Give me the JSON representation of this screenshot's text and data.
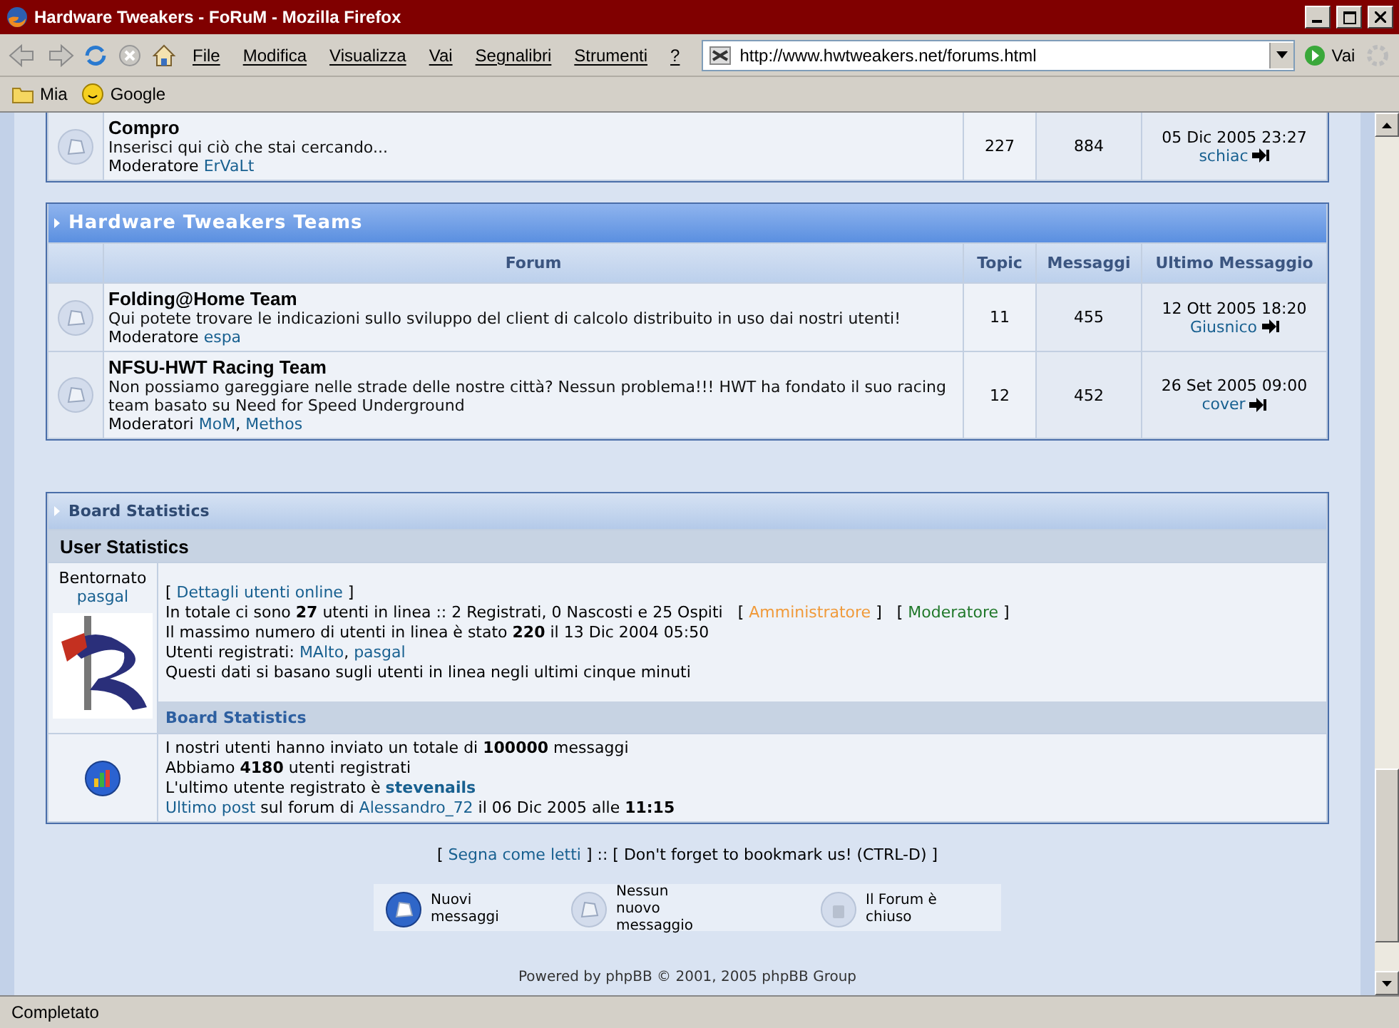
{
  "window": {
    "title": "Hardware Tweakers - FoRuM - Mozilla Firefox"
  },
  "menu": [
    "File",
    "Modifica",
    "Visualizza",
    "Vai",
    "Segnalibri",
    "Strumenti",
    "?"
  ],
  "address": {
    "value": "http://www.hwtweakers.net/forums.html",
    "go": "Vai"
  },
  "bookmarks": [
    {
      "label": "Mia",
      "kind": "folder"
    },
    {
      "label": "Google",
      "kind": "smiley"
    }
  ],
  "sections": [
    {
      "forums": [
        {
          "name": "Compro",
          "description": "Inserisci qui ciò che stai cercando...",
          "moderator_label": "Moderatore",
          "moderators": [
            "ErVaLt"
          ],
          "topics": "227",
          "posts": "884",
          "last_date": "05 Dic 2005 23:27",
          "last_user": "schiac"
        }
      ]
    },
    {
      "title": "Hardware Tweakers Teams",
      "columns": [
        "Forum",
        "Topic",
        "Messaggi",
        "Ultimo Messaggio"
      ],
      "forums": [
        {
          "name": "Folding@Home Team",
          "description": "Qui potete trovare le indicazioni sullo sviluppo del client di calcolo distribuito in uso dai nostri utenti!",
          "moderator_label": "Moderatore",
          "moderators": [
            "espa"
          ],
          "topics": "11",
          "posts": "455",
          "last_date": "12 Ott 2005 18:20",
          "last_user": "Giusnico"
        },
        {
          "name": "NFSU-HWT Racing Team",
          "description": "Non possiamo gareggiare nelle strade delle nostre città? Nessun problema!!! HWT ha fondato il suo racing team basato su Need for Speed Underground",
          "moderator_label": "Moderatori",
          "moderators": [
            "MoM",
            ", ",
            "Methos"
          ],
          "topics": "12",
          "posts": "452",
          "last_date": "26 Set 2005 09:00",
          "last_user": "cover"
        }
      ]
    }
  ],
  "stats": {
    "title": "Board Statistics",
    "subtitle": "User Statistics",
    "welcome": "Bentornato",
    "user": "pasgal",
    "online_lines": [
      [
        {
          "kind": "text",
          "text": "[ "
        },
        {
          "kind": "link",
          "text": "Dettagli utenti online"
        },
        {
          "kind": "text",
          "text": " ]"
        }
      ],
      [
        {
          "kind": "text",
          "text": "In totale ci sono **27** utenti in linea :: 2 Registrati, 0 Nascosti e 25 Ospiti   [ "
        },
        {
          "kind": "admin",
          "text": "Amministratore"
        },
        {
          "kind": "text",
          "text": " ]   [ "
        },
        {
          "kind": "mod",
          "text": "Moderatore"
        },
        {
          "kind": "text",
          "text": " ]"
        }
      ],
      [
        {
          "kind": "text",
          "text": "Il massimo numero di utenti in linea è stato **220** il 13 Dic 2004 05:50"
        }
      ],
      [
        {
          "kind": "text",
          "text": "Utenti registrati: "
        },
        {
          "kind": "link",
          "text": "MAlto"
        },
        {
          "kind": "text",
          "text": ", "
        },
        {
          "kind": "link",
          "text": "pasgal"
        }
      ],
      [
        {
          "kind": "text",
          "text": "Questi dati si basano sugli utenti in linea negli ultimi cinque minuti"
        }
      ]
    ],
    "board_title": "Board Statistics",
    "board_lines": [
      [
        {
          "kind": "text",
          "text": "I nostri utenti hanno inviato un totale di **100000** messaggi"
        }
      ],
      [
        {
          "kind": "text",
          "text": "Abbiamo **4180** utenti registrati"
        }
      ],
      [
        {
          "kind": "text",
          "text": "L'ultimo utente registrato è "
        },
        {
          "kind": "user",
          "text": "stevenails"
        }
      ],
      [
        {
          "kind": "link",
          "text": "Ultimo post"
        },
        {
          "kind": "text",
          "text": " sul forum di "
        },
        {
          "kind": "link",
          "text": "Alessandro_72"
        },
        {
          "kind": "text",
          "text": " il 06 Dic 2005 alle **11:15**"
        }
      ]
    ]
  },
  "links": [
    {
      "kind": "text",
      "text": "[ "
    },
    {
      "kind": "link",
      "text": "Segna come letti"
    },
    {
      "kind": "text",
      "text": " ] :: [ Don't forget to bookmark us! (CTRL-D) ]"
    }
  ],
  "legend": [
    {
      "kind": "new",
      "label": "Nuovi messaggi"
    },
    {
      "kind": "none",
      "label": "Nessun nuovo messaggio"
    },
    {
      "kind": "locked",
      "label": "Il Forum è chiuso"
    }
  ],
  "footer": "Powered by phpBB © 2001, 2005 phpBB Group",
  "status_bar": "Completato"
}
